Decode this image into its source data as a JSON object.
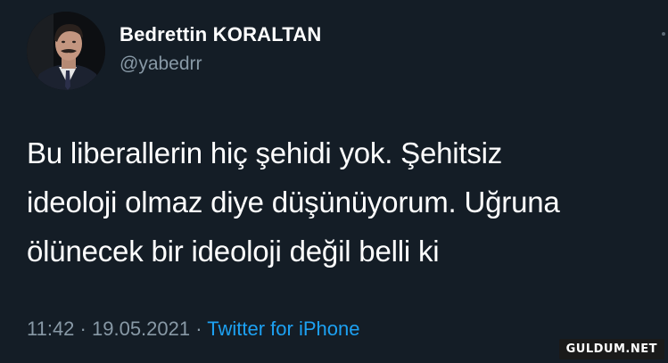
{
  "author": {
    "name": "Bedrettin KORALTAN",
    "handle": "@yabedrr"
  },
  "tweet": {
    "lines": [
      "Bu liberallerin hiç şehidi yok. Şehitsiz",
      "ideoloji olmaz diye düşünüyorum. Uğruna",
      "ölünecek bir ideoloji değil belli ki"
    ]
  },
  "meta": {
    "time": "11:42",
    "separator": "·",
    "date": "19.05.2021",
    "source": "Twitter for iPhone"
  },
  "watermark": "GULDUM.NET",
  "colors": {
    "background": "#141d26",
    "text": "#ffffff",
    "secondary": "#8899a6",
    "link": "#1da1f2"
  },
  "icons": {
    "more": "more-options-icon"
  }
}
